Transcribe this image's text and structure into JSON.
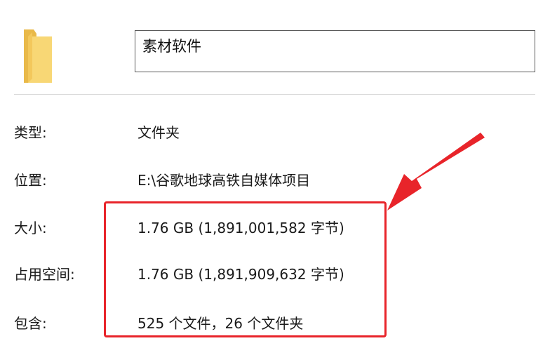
{
  "header": {
    "folder_icon": "folder-icon",
    "name_value": "素材软件"
  },
  "properties": [
    {
      "label": "类型:",
      "value": "文件夹"
    },
    {
      "label": "位置:",
      "value": "E:\\谷歌地球高铁自媒体项目"
    },
    {
      "label": "大小:",
      "value": "1.76 GB (1,891,001,582 字节)"
    },
    {
      "label": "占用空间:",
      "value": "1.76 GB (1,891,909,632 字节)"
    },
    {
      "label": "包含:",
      "value": "525 个文件，26 个文件夹"
    }
  ],
  "annotation": {
    "highlight_color": "#e8242a",
    "arrow_icon": "red-arrow-icon"
  },
  "colors": {
    "folder_light": "#f8d775",
    "folder_dark": "#e9b949"
  }
}
